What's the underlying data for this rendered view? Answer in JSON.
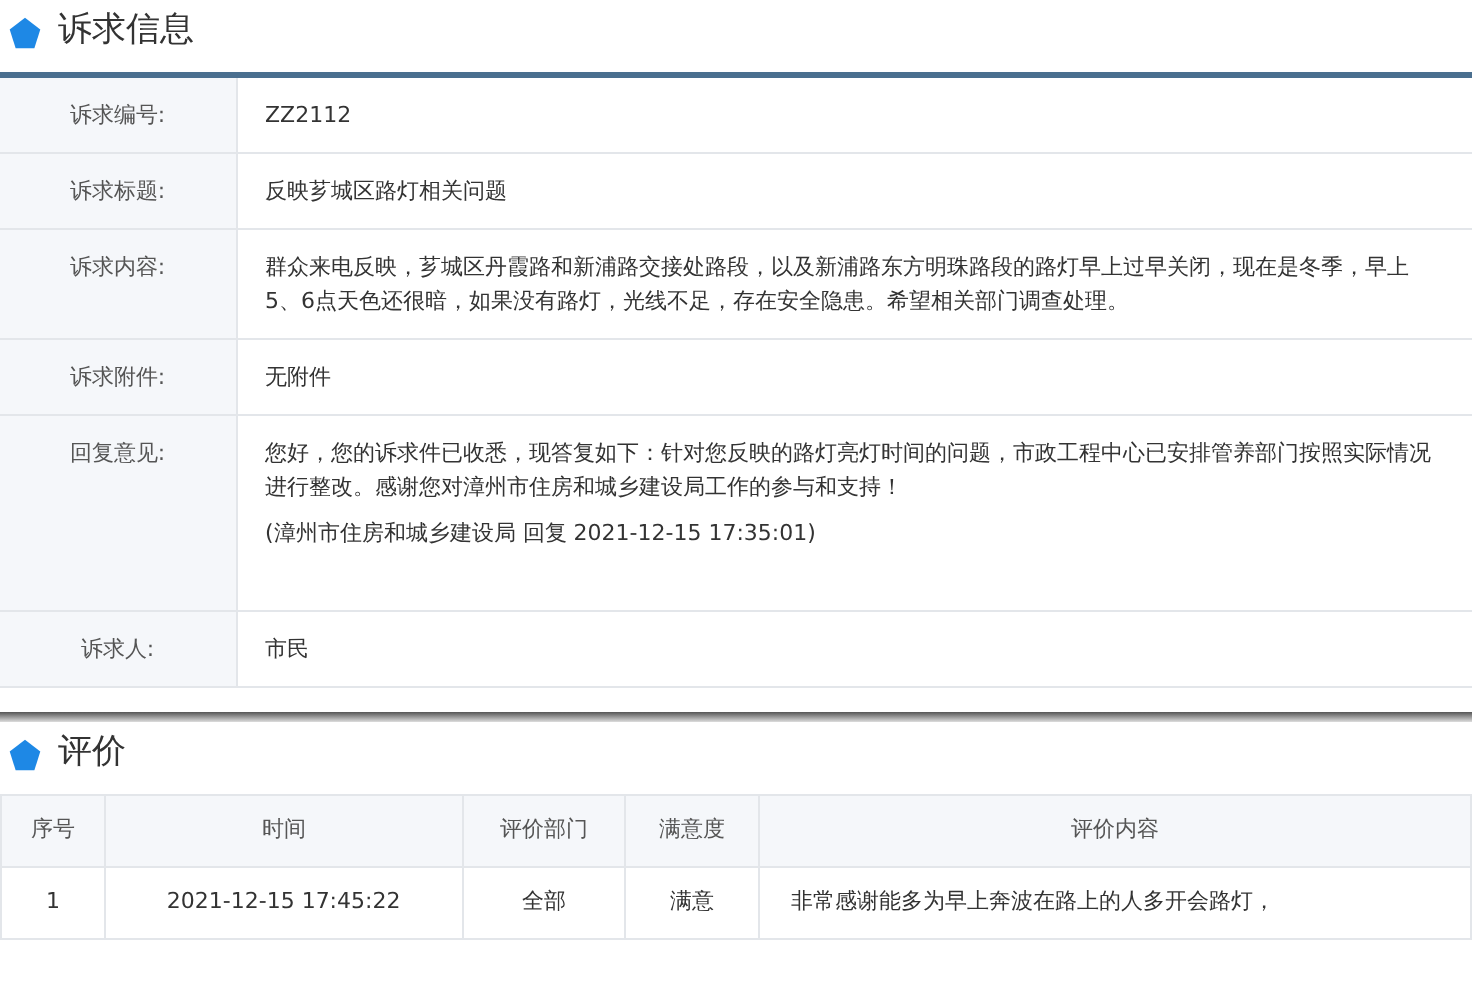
{
  "appeal_section": {
    "title": "诉求信息",
    "fields": [
      {
        "label": "诉求编号:",
        "paragraphs": [
          "ZZ2112"
        ]
      },
      {
        "label": "诉求标题:",
        "paragraphs": [
          "反映芗城区路灯相关问题"
        ]
      },
      {
        "label": "诉求内容:",
        "paragraphs": [
          "群众来电反映，芗城区丹霞路和新浦路交接处路段，以及新浦路东方明珠路段的路灯早上过早关闭，现在是冬季，早上5、6点天色还很暗，如果没有路灯，光线不足，存在安全隐患。希望相关部门调查处理。"
        ]
      },
      {
        "label": "诉求附件:",
        "paragraphs": [
          "无附件"
        ]
      },
      {
        "label": "回复意见:",
        "paragraphs": [
          "您好，您的诉求件已收悉，现答复如下：针对您反映的路灯亮灯时间的问题，市政工程中心已安排管养部门按照实际情况进行整改。感谢您对漳州市住房和城乡建设局工作的参与和支持！",
          "(漳州市住房和城乡建设局 回复 2021-12-15 17:35:01)"
        ]
      },
      {
        "label": "诉求人:",
        "paragraphs": [
          "市民"
        ]
      }
    ]
  },
  "evaluation_section": {
    "title": "评价",
    "table": {
      "columns": [
        "序号",
        "时间",
        "评价部门",
        "满意度",
        "评价内容"
      ],
      "rows": [
        [
          "1",
          "2021-12-15 17:45:22",
          "全部",
          "满意",
          "非常感谢能多为早上奔波在路上的人多开会路灯，"
        ]
      ]
    }
  }
}
